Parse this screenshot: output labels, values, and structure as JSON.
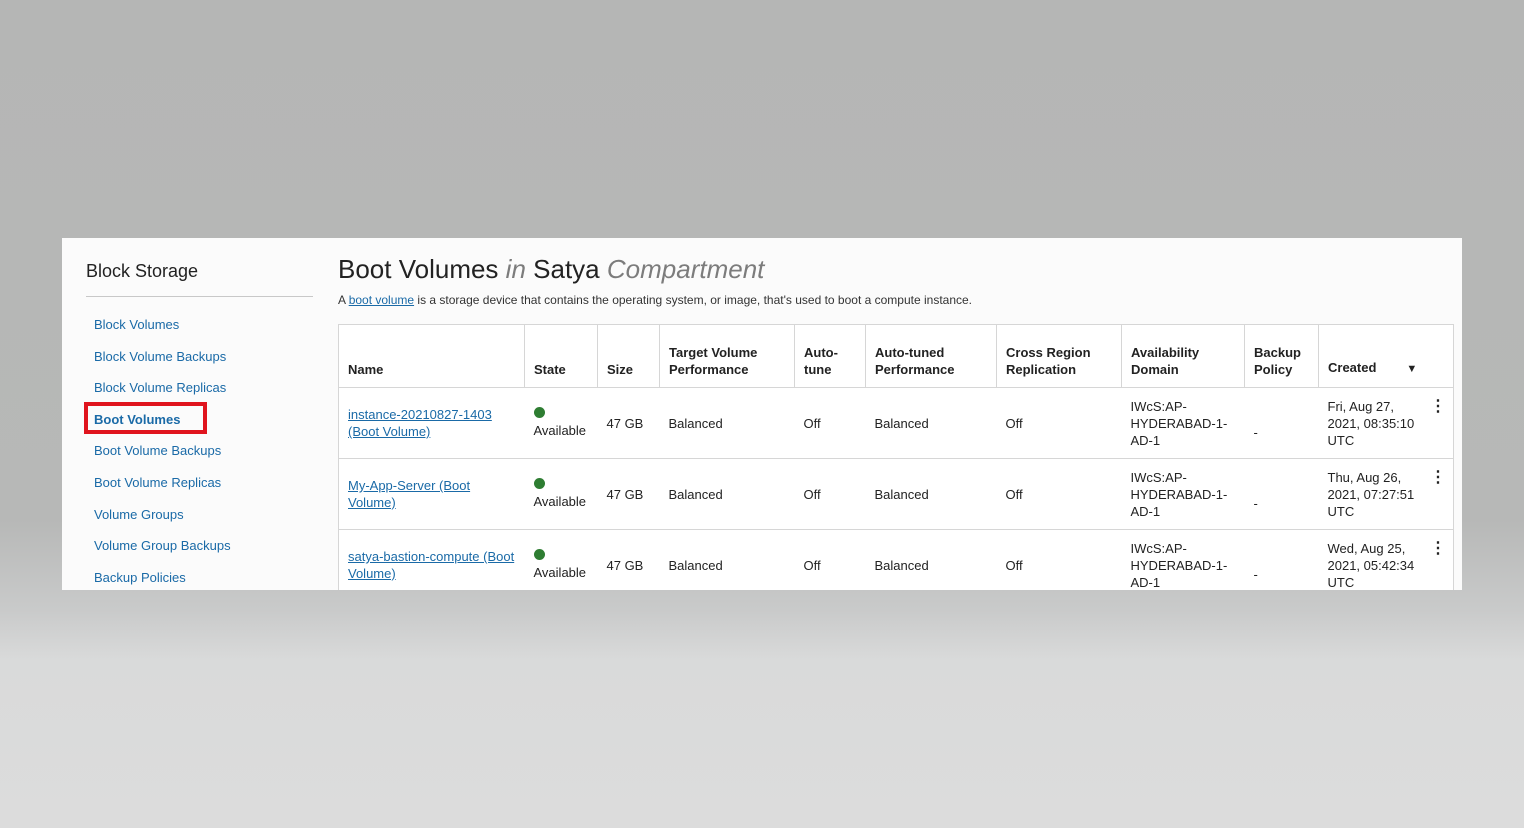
{
  "sidebar": {
    "title": "Block Storage",
    "items": [
      {
        "label": "Block Volumes",
        "active": false
      },
      {
        "label": "Block Volume Backups",
        "active": false
      },
      {
        "label": "Block Volume Replicas",
        "active": false
      },
      {
        "label": "Boot Volumes",
        "active": true
      },
      {
        "label": "Boot Volume Backups",
        "active": false
      },
      {
        "label": "Boot Volume Replicas",
        "active": false
      },
      {
        "label": "Volume Groups",
        "active": false
      },
      {
        "label": "Volume Group Backups",
        "active": false
      },
      {
        "label": "Backup Policies",
        "active": false
      }
    ]
  },
  "header": {
    "title": "Boot Volumes",
    "in_word": "in",
    "compartment": "Satya",
    "compartment_word": "Compartment",
    "intro_prefix": "A",
    "intro_link": "boot volume",
    "intro_suffix": "is a storage device that contains the operating system, or image, that's used to boot a compute instance."
  },
  "table": {
    "columns": [
      {
        "label": "Name"
      },
      {
        "label": "State"
      },
      {
        "label": "Size"
      },
      {
        "label": "Target Volume Performance"
      },
      {
        "label": "Auto-tune"
      },
      {
        "label": "Auto-tuned Performance"
      },
      {
        "label": "Cross Region Replication"
      },
      {
        "label": "Availability Domain"
      },
      {
        "label": "Backup Policy"
      },
      {
        "label": "Created"
      }
    ],
    "sort_icon": "caret-down-icon",
    "rows": [
      {
        "name": "instance-20210827-1403 (Boot Volume)",
        "state": "Available",
        "size": "47 GB",
        "target_perf": "Balanced",
        "auto_tune": "Off",
        "auto_tuned_perf": "Balanced",
        "cross_region": "Off",
        "availability_domain": "IWcS:AP-HYDERABAD-1-AD-1",
        "backup_policy": "-",
        "created": "Fri, Aug 27, 2021, 08:35:10 UTC"
      },
      {
        "name": "My-App-Server (Boot Volume)",
        "state": "Available",
        "size": "47 GB",
        "target_perf": "Balanced",
        "auto_tune": "Off",
        "auto_tuned_perf": "Balanced",
        "cross_region": "Off",
        "availability_domain": "IWcS:AP-HYDERABAD-1-AD-1",
        "backup_policy": "-",
        "created": "Thu, Aug 26, 2021, 07:27:51 UTC"
      },
      {
        "name": "satya-bastion-compute (Boot Volume)",
        "state": "Available",
        "size": "47 GB",
        "target_perf": "Balanced",
        "auto_tune": "Off",
        "auto_tuned_perf": "Balanced",
        "cross_region": "Off",
        "availability_domain": "IWcS:AP-HYDERABAD-1-AD-1",
        "backup_policy": "-",
        "created": "Wed, Aug 25, 2021, 05:42:34 UTC"
      }
    ]
  },
  "colors": {
    "link": "#1a6aa7",
    "available": "#2e7d32",
    "highlight": "#e0141e"
  }
}
